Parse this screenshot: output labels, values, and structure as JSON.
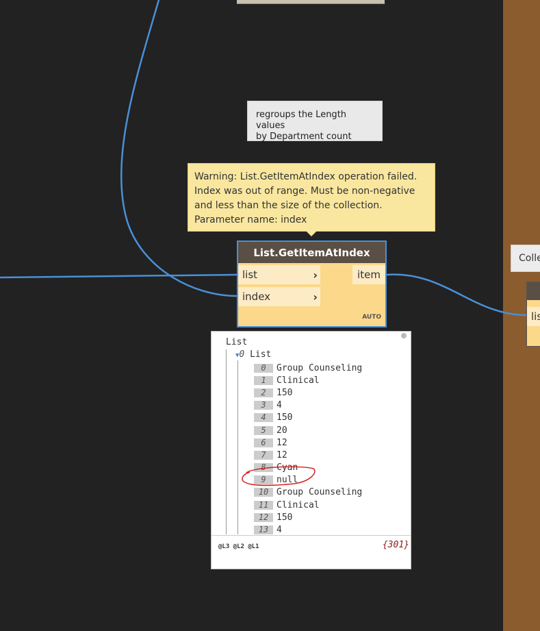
{
  "note": {
    "lines": [
      "regroups the Length values",
      "by Department count"
    ]
  },
  "warning": {
    "lines": [
      "Warning: List.GetItemAtIndex operation failed.",
      "Index was out of range. Must be non-negative",
      "and less than the size of the collection.",
      "Parameter name: index"
    ]
  },
  "node": {
    "title": "List.GetItemAtIndex",
    "inputs": [
      "list",
      "index"
    ],
    "output": "item",
    "lacing": "AUTO",
    "input_arrow": "›"
  },
  "preview": {
    "root_label": "List",
    "sub_index": "0",
    "sub_label": "List",
    "items": [
      {
        "index": "0",
        "value": "Group Counseling"
      },
      {
        "index": "1",
        "value": "Clinical"
      },
      {
        "index": "2",
        "value": "150"
      },
      {
        "index": "3",
        "value": "4"
      },
      {
        "index": "4",
        "value": "150"
      },
      {
        "index": "5",
        "value": "20"
      },
      {
        "index": "6",
        "value": "12"
      },
      {
        "index": "7",
        "value": "12"
      },
      {
        "index": "8",
        "value": "Cyan"
      },
      {
        "index": "9",
        "value": "null"
      },
      {
        "index": "10",
        "value": "Group Counseling"
      },
      {
        "index": "11",
        "value": "Clinical"
      },
      {
        "index": "12",
        "value": "150"
      },
      {
        "index": "13",
        "value": "4"
      }
    ],
    "levels": "@L3 @L2 @L1",
    "count": "{301}"
  },
  "side_note": {
    "text": "Colle"
  },
  "side_node": {
    "port": "lis"
  },
  "colors": {
    "canvas": "#222222",
    "wire": "#4a90d9",
    "node_body": "#fcd88a",
    "node_header": "#5a4f44",
    "warning_bg": "#f9e79f",
    "annotation_circle": "#d62020",
    "side_panel": "#8b5c2e"
  }
}
